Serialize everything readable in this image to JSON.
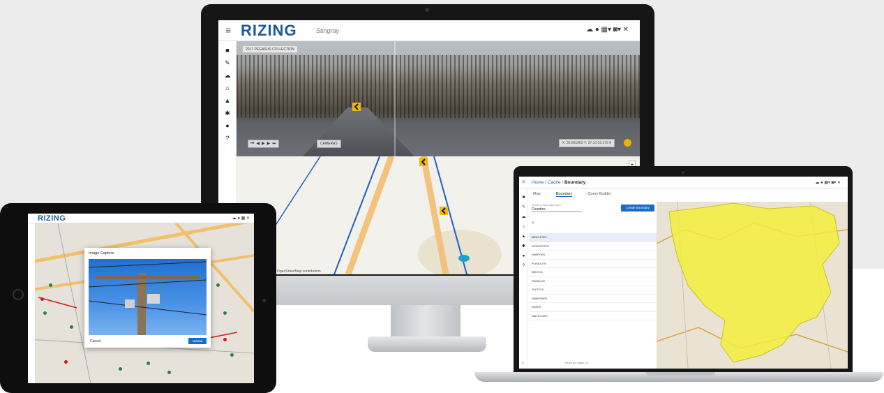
{
  "monitor": {
    "app_title": "RIZING",
    "app_subtitle": "Stingray",
    "menu_icon": "≡",
    "top_icons": [
      "cloud-icon",
      "user-icon",
      "grid-icon",
      "camera-icon",
      "close-icon"
    ],
    "top_icon_glyphs": "☁ ● ▦▾ ◙▾ ✕",
    "collection_button": "2017 PEGASUS COLLECTION",
    "camera_button": "CAMERAS",
    "coordinate_readout": "X: 36.661802 Y: 37.10 33.173 ft",
    "map_attribution": "OpenStreetMap contributors",
    "zoom_glyph": "+"
  },
  "tablet": {
    "app_title": "RIZING",
    "modal_title": "Image Capture",
    "cancel_label": "Cancel",
    "upload_label": "Upload"
  },
  "laptop": {
    "breadcrumb_home": "Home",
    "breadcrumb_sep1": " / ",
    "breadcrumb_mid": "Cache",
    "breadcrumb_sep2": " / ",
    "breadcrumb_current": "Boundary",
    "tabs": [
      "Map",
      "Boundary",
      "Query Builder"
    ],
    "select_label": "Select a boundary layer",
    "select_value": "Counties",
    "create_button": "Create Boundary",
    "table_rows": [
      "MIDDLESEX",
      "WORCESTER",
      "HAMPDEN",
      "PLYMOUTH",
      "BRISTOL",
      "FRANKLIN",
      "SUFFOLK",
      "HAMPSHIRE",
      "DUKES",
      "NANTUCKET"
    ],
    "rows_per_page_label": "Items per page: 10"
  },
  "colors": {
    "brand_blue": "#1a5a99",
    "button_blue": "#1a6bc7",
    "boundary_yellow": "#f2ee3b",
    "road_orange": "#f2c27e"
  }
}
